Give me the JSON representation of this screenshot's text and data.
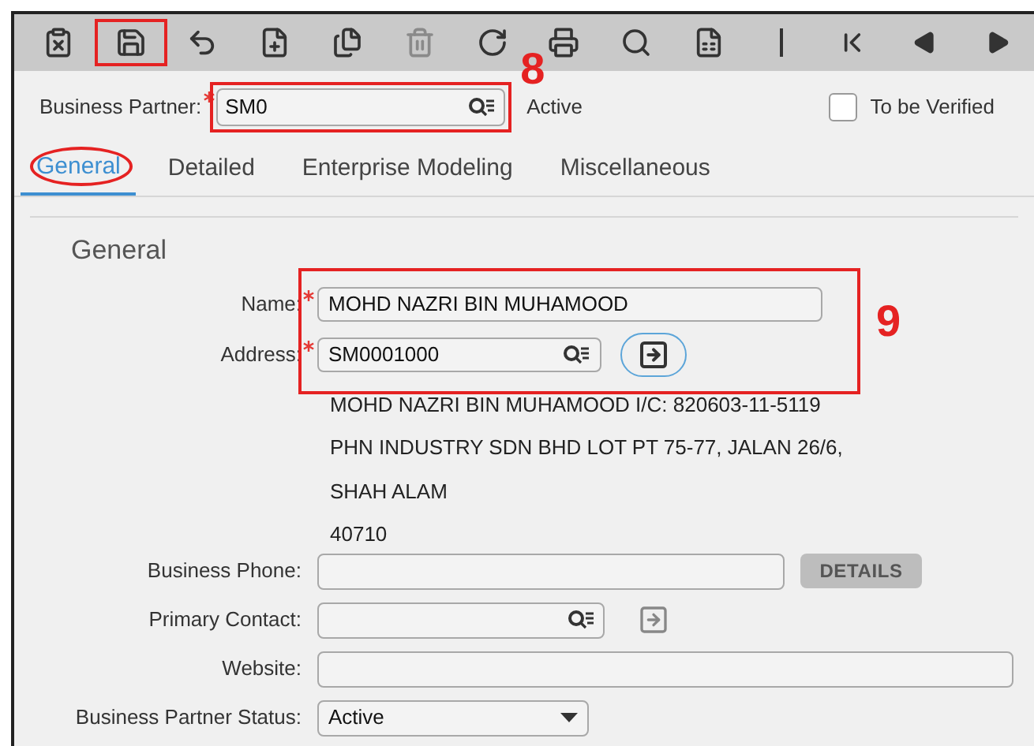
{
  "toolbar": [
    {
      "kind": "clear",
      "disabled": false,
      "annotated": false
    },
    {
      "kind": "save",
      "disabled": false,
      "annotated": true
    },
    {
      "kind": "undo",
      "disabled": false,
      "annotated": false
    },
    {
      "kind": "new",
      "disabled": false,
      "annotated": false
    },
    {
      "kind": "copy",
      "disabled": false,
      "annotated": false
    },
    {
      "kind": "delete",
      "disabled": true,
      "annotated": false
    },
    {
      "kind": "refresh",
      "disabled": false,
      "annotated": false
    },
    {
      "kind": "print",
      "disabled": false,
      "annotated": false
    },
    {
      "kind": "find",
      "disabled": false,
      "annotated": false
    },
    {
      "kind": "report",
      "disabled": false,
      "annotated": false
    },
    {
      "kind": "divider"
    },
    {
      "kind": "first",
      "disabled": false,
      "annotated": false
    },
    {
      "kind": "previous",
      "disabled": false,
      "annotated": false
    },
    {
      "kind": "next",
      "disabled": false,
      "annotated": false
    }
  ],
  "header": {
    "label": "Business Partner:",
    "required": true,
    "value": "SM0",
    "callout": "8",
    "status": "Active",
    "verify": {
      "label": "To be Verified",
      "checked": false
    }
  },
  "tabs": [
    {
      "label": "General",
      "selected": true,
      "circled": true
    },
    {
      "label": "Detailed",
      "selected": false,
      "circled": false
    },
    {
      "label": "Enterprise Modeling",
      "selected": false,
      "circled": false
    },
    {
      "label": "Miscellaneous",
      "selected": false,
      "circled": false
    }
  ],
  "section": {
    "title": "General",
    "callout": "9",
    "name": {
      "label": "Name:",
      "required": true,
      "value": "MOHD NAZRI BIN MUHAMOOD"
    },
    "address": {
      "label": "Address:",
      "required": true,
      "value": "SM0001000",
      "lines": [
        "MOHD NAZRI BIN MUHAMOOD I/C: 820603-11-5119",
        "PHN INDUSTRY SDN BHD LOT PT 75-77, JALAN 26/6,",
        "SHAH ALAM",
        "40710"
      ]
    },
    "phone": {
      "label": "Business Phone:",
      "button": "DETAILS"
    },
    "contact": {
      "label": "Primary Contact:"
    },
    "website": {
      "label": "Website:"
    },
    "status": {
      "label": "Business Partner Status:",
      "value": "Active"
    }
  }
}
